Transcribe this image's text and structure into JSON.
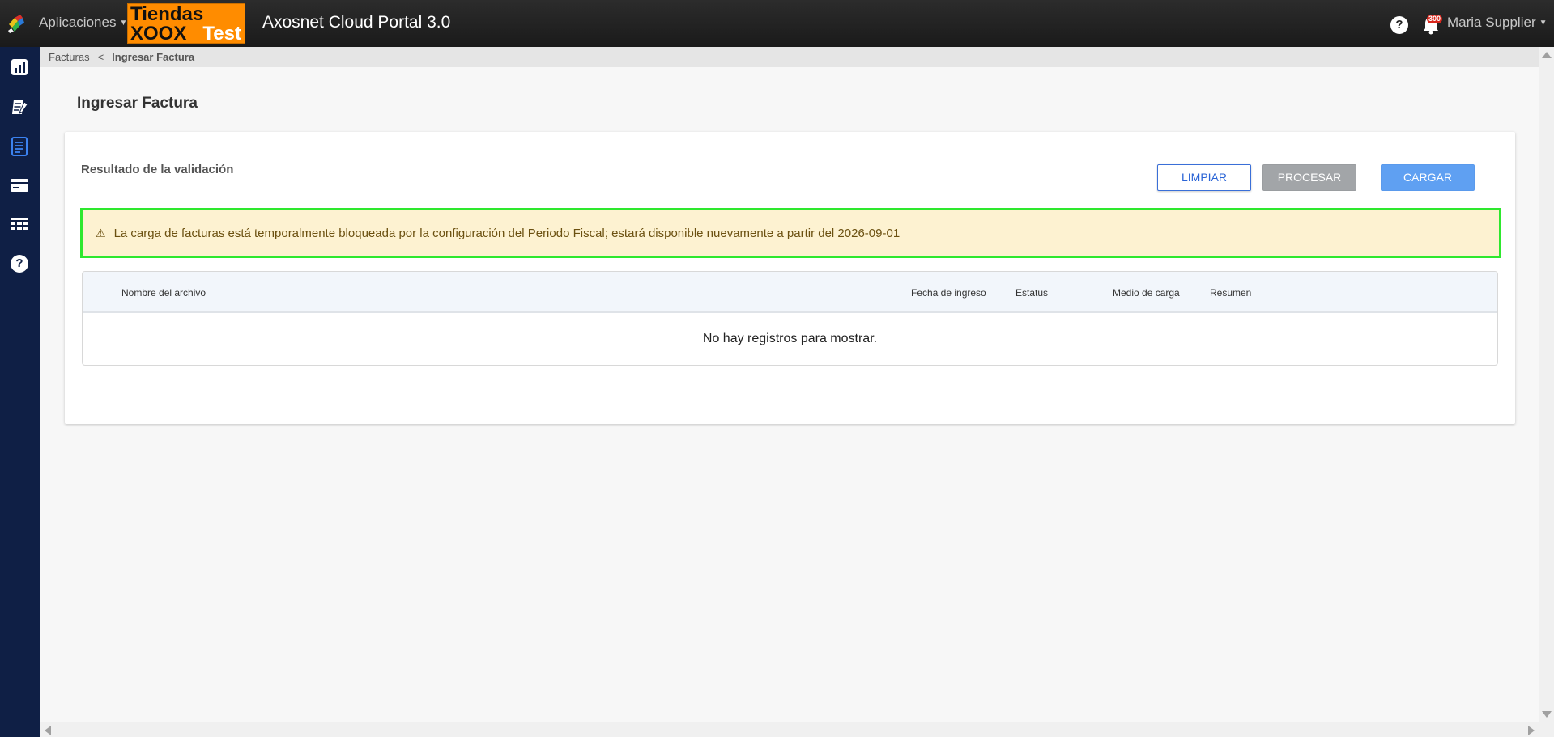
{
  "header": {
    "apps_label": "Aplicaciones",
    "tenant_logo": {
      "line1": "Tiendas",
      "line2": "XOOX",
      "line3": "Test"
    },
    "portal_title": "Axosnet Cloud Portal 3.0",
    "help_glyph": "?",
    "notifications_count": "300",
    "user_name": "Maria Supplier"
  },
  "sidebar": {
    "items": [
      {
        "icon": "bar-chart-icon"
      },
      {
        "icon": "edit-document-icon"
      },
      {
        "icon": "document-list-icon",
        "active": true
      },
      {
        "icon": "credit-card-icon"
      },
      {
        "icon": "table-icon"
      },
      {
        "icon": "help-icon",
        "glyph": "?"
      }
    ]
  },
  "breadcrumb": {
    "parent": "Facturas",
    "separator": "<",
    "current": "Ingresar Factura"
  },
  "page": {
    "title": "Ingresar Factura",
    "section_title": "Resultado de la validación",
    "buttons": {
      "clear": "LIMPIAR",
      "process": "PROCESAR",
      "load": "CARGAR"
    },
    "alert": {
      "icon_glyph": "⚠",
      "message": "La carga de facturas está temporalmente bloqueada por la configuración del Periodo Fiscal; estará disponible nuevamente a partir del 2026-09-01"
    },
    "table": {
      "columns": [
        "Nombre del archivo",
        "Fecha de ingreso",
        "Estatus",
        "Medio de carga",
        "Resumen"
      ],
      "empty_message": "No hay registros para mostrar."
    }
  },
  "colors": {
    "topbar": "#1f1f1f",
    "sidebar": "#0f1f45",
    "accent": "#2a64d6",
    "alert_bg": "#fdf2d1",
    "alert_border": "#2ee82e",
    "logo_orange": "#ff8c00"
  }
}
